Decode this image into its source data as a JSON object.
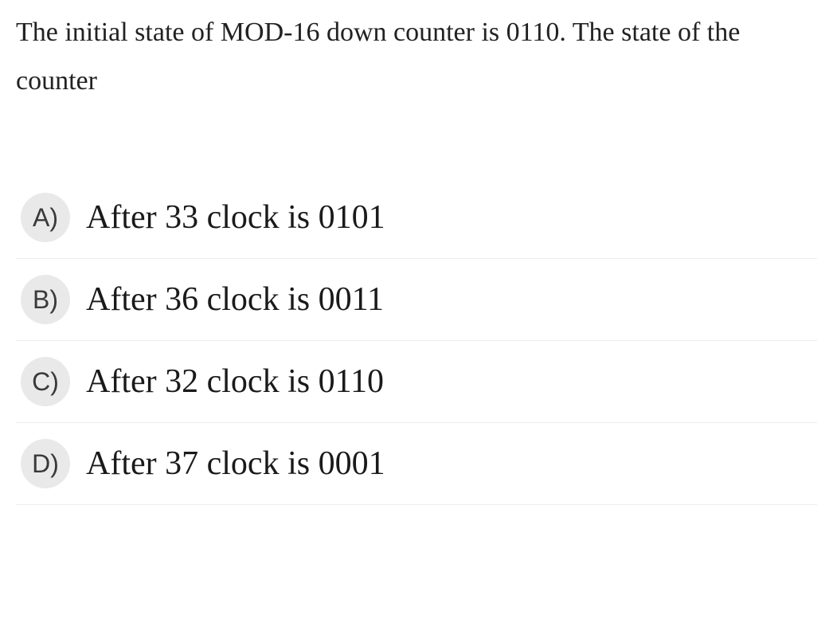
{
  "question": "The initial state of MOD-16 down counter is 0110. The state of the counter",
  "options": [
    {
      "letter": "A)",
      "text": "After 33 clock is 0101"
    },
    {
      "letter": "B)",
      "text": "After 36 clock is 0011"
    },
    {
      "letter": "C)",
      "text": "After 32 clock is 0110"
    },
    {
      "letter": "D)",
      "text": "After 37 clock is 0001"
    }
  ]
}
